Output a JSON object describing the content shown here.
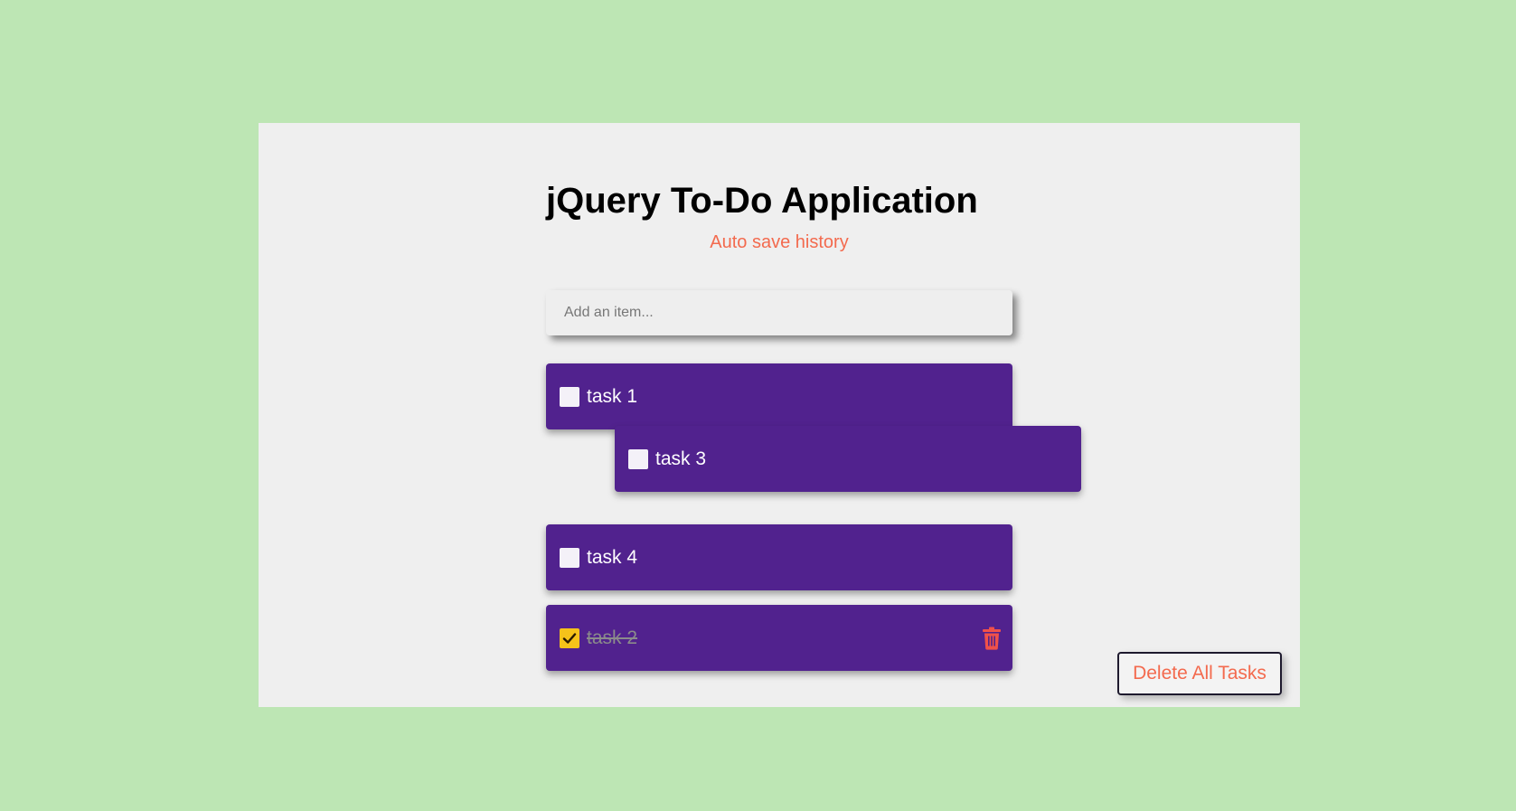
{
  "app": {
    "title": "jQuery To-Do Application",
    "subtitle": "Auto save history"
  },
  "input": {
    "placeholder": "Add an item...",
    "value": ""
  },
  "tasks": [
    {
      "label": "task 1",
      "checked": false
    },
    {
      "label": "task 3",
      "checked": false,
      "state": "being dragged"
    },
    {
      "label": "task 4",
      "checked": false
    },
    {
      "label": "task 2",
      "checked": true
    }
  ],
  "actions": {
    "delete_all_label": "Delete All Tasks"
  },
  "icons": {
    "checkmark": "check-icon",
    "delete": "trash-icon"
  },
  "colors": {
    "background": "#bde6b4",
    "panel": "#efefef",
    "task_bg": "#51228e",
    "accent": "#f36a4e",
    "checked": "#f6c21a"
  }
}
